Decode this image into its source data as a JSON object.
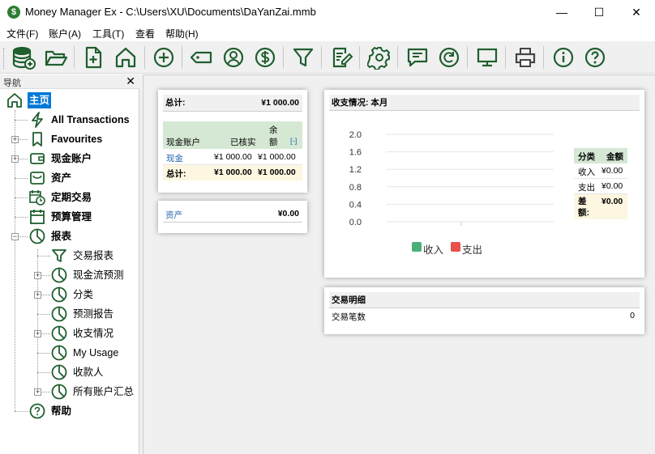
{
  "window": {
    "title": "Money Manager Ex - C:\\Users\\XU\\Documents\\DaYanZai.mmb",
    "app_icon": "$",
    "minimize": "—",
    "maximize": "☐",
    "close": "✕"
  },
  "menubar": {
    "file": "文件(F)",
    "accounts": "账户(A)",
    "tools": "工具(T)",
    "view": "查看",
    "help": "帮助(H)"
  },
  "toolbar": {
    "icons": [
      "database-add",
      "folder-open",
      "new-document",
      "home",
      "add-circle",
      "tag",
      "user-circle",
      "dollar-circle",
      "filter",
      "edit",
      "gear",
      "chat",
      "refresh",
      "monitor",
      "printer",
      "info",
      "help"
    ]
  },
  "nav": {
    "title": "导航",
    "close": "✕",
    "items": [
      {
        "label": "主页",
        "icon": "home-icon"
      },
      {
        "label": "All Transactions",
        "icon": "lightning-icon"
      },
      {
        "label": "Favourites",
        "icon": "bookmark-icon"
      },
      {
        "label": "现金账户",
        "icon": "wallet-icon"
      },
      {
        "label": "资产",
        "icon": "basket-icon"
      },
      {
        "label": "定期交易",
        "icon": "calendar-clock-icon"
      },
      {
        "label": "预算管理",
        "icon": "calendar-icon"
      },
      {
        "label": "报表",
        "icon": "pie-chart-icon"
      },
      {
        "label": "交易报表",
        "icon": "filter-icon"
      },
      {
        "label": "现金流预测",
        "icon": "pie-chart-icon"
      },
      {
        "label": "分类",
        "icon": "pie-chart-icon"
      },
      {
        "label": "预测报告",
        "icon": "pie-chart-icon"
      },
      {
        "label": "收支情况",
        "icon": "pie-chart-icon"
      },
      {
        "label": "My Usage",
        "icon": "pie-chart-icon"
      },
      {
        "label": "收款人",
        "icon": "pie-chart-icon"
      },
      {
        "label": "所有账户汇总",
        "icon": "pie-chart-icon"
      },
      {
        "label": "帮助",
        "icon": "help-icon"
      }
    ]
  },
  "summary": {
    "total_label": "总计:",
    "total_value": "¥1 000.00",
    "headers": {
      "account": "现金账户",
      "reconciled": "已核实",
      "balance": "余\n额",
      "collapse": "[-]"
    },
    "rows": [
      {
        "name": "现金",
        "reconciled": "¥1 000.00",
        "balance": "¥1 000.00"
      }
    ],
    "footer": {
      "label": "总计:",
      "reconciled": "¥1 000.00",
      "balance": "¥1 000.00"
    }
  },
  "assets": {
    "label": "资产",
    "value": "¥0.00"
  },
  "income_expense": {
    "title": "收支情况: 本月",
    "legend": {
      "income": "收入",
      "expense": "支出"
    },
    "table": {
      "h_cat": "分类",
      "h_amt": "金额",
      "income_label": "收入",
      "income_val": "¥0.00",
      "expense_label": "支出",
      "expense_val": "¥0.00",
      "diff_label": "差额:",
      "diff_val": "¥0.00"
    }
  },
  "transactions": {
    "title": "交易明细",
    "count_label": "交易笔数",
    "count_value": "0"
  },
  "colors": {
    "brand_green": "#2e7d32",
    "income": "#4caf7a",
    "expense": "#e8504a",
    "selected": "#0078d7"
  },
  "chart_data": {
    "type": "bar",
    "categories": [
      ""
    ],
    "series": [
      {
        "name": "收入",
        "values": [
          0
        ]
      },
      {
        "name": "支出",
        "values": [
          0
        ]
      }
    ],
    "ylim": [
      0,
      2.0
    ],
    "yticks": [
      "2.0",
      "1.6",
      "1.2",
      "0.8",
      "0.4",
      "0.0"
    ],
    "legend": "bottom"
  }
}
